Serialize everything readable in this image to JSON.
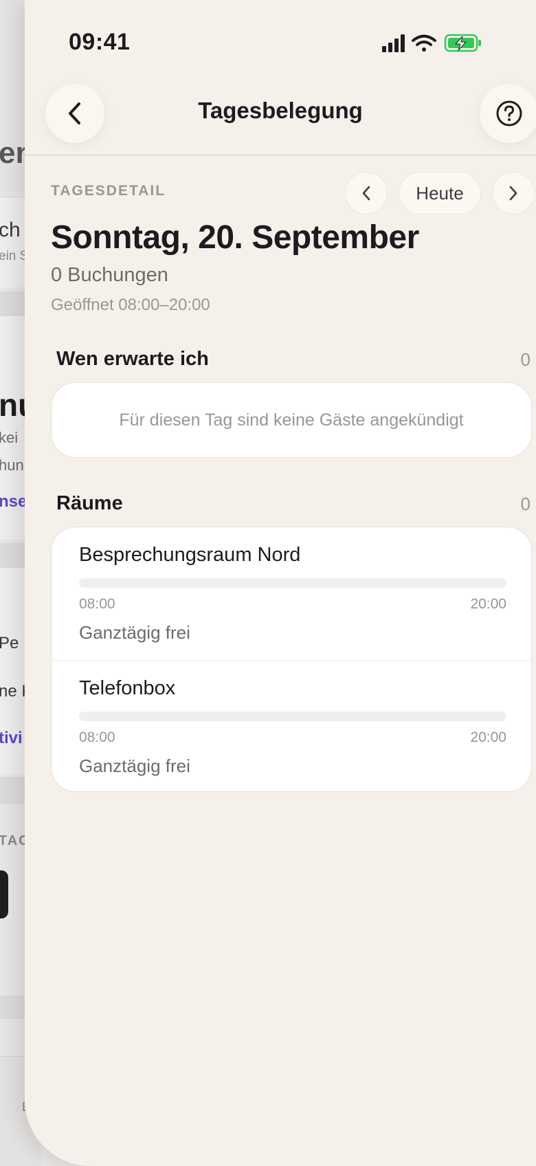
{
  "status_bar": {
    "time": "09:41",
    "icons": [
      "signal-icon",
      "wifi-icon",
      "battery-charging-icon"
    ],
    "battery_color": "#35c759"
  },
  "nav": {
    "title": "Tagesbelegung",
    "back_icon": "chevron-left-icon",
    "help_icon": "help-circle-icon"
  },
  "day": {
    "eyebrow": "TAGESDETAIL",
    "prev_icon": "chevron-left-icon",
    "today_label": "Heute",
    "next_icon": "chevron-right-icon",
    "date_title": "Sonntag, 20. September",
    "bookings": "0 Buchungen",
    "opening_hours": "Geöffnet 08:00–20:00"
  },
  "guests": {
    "heading": "Wen erwarte ich",
    "count": "0",
    "empty_message": "Für diesen Tag sind keine Gäste angekündigt"
  },
  "rooms": {
    "heading": "Räume",
    "count": "0",
    "items": [
      {
        "name": "Besprechungsraum Nord",
        "start": "08:00",
        "end": "20:00",
        "status": "Ganztägig frei",
        "occupancy": 0
      },
      {
        "name": "Telefonbox",
        "start": "08:00",
        "end": "20:00",
        "status": "Ganztägig frei",
        "occupancy": 0
      }
    ]
  },
  "background_screen": {
    "fragments": [
      "en",
      "ch",
      "ein S",
      "nu",
      "kei",
      "hun",
      "nse",
      "Pe",
      "ne K",
      "tivi",
      "TAG",
      "E"
    ],
    "accent_color": "#5b4bc4"
  },
  "colors": {
    "sheet_background": "#f5f1ea",
    "card_background": "#ffffff",
    "text_primary": "#1c1b1f",
    "text_secondary": "#6e6a66",
    "text_muted": "#9a9691"
  }
}
